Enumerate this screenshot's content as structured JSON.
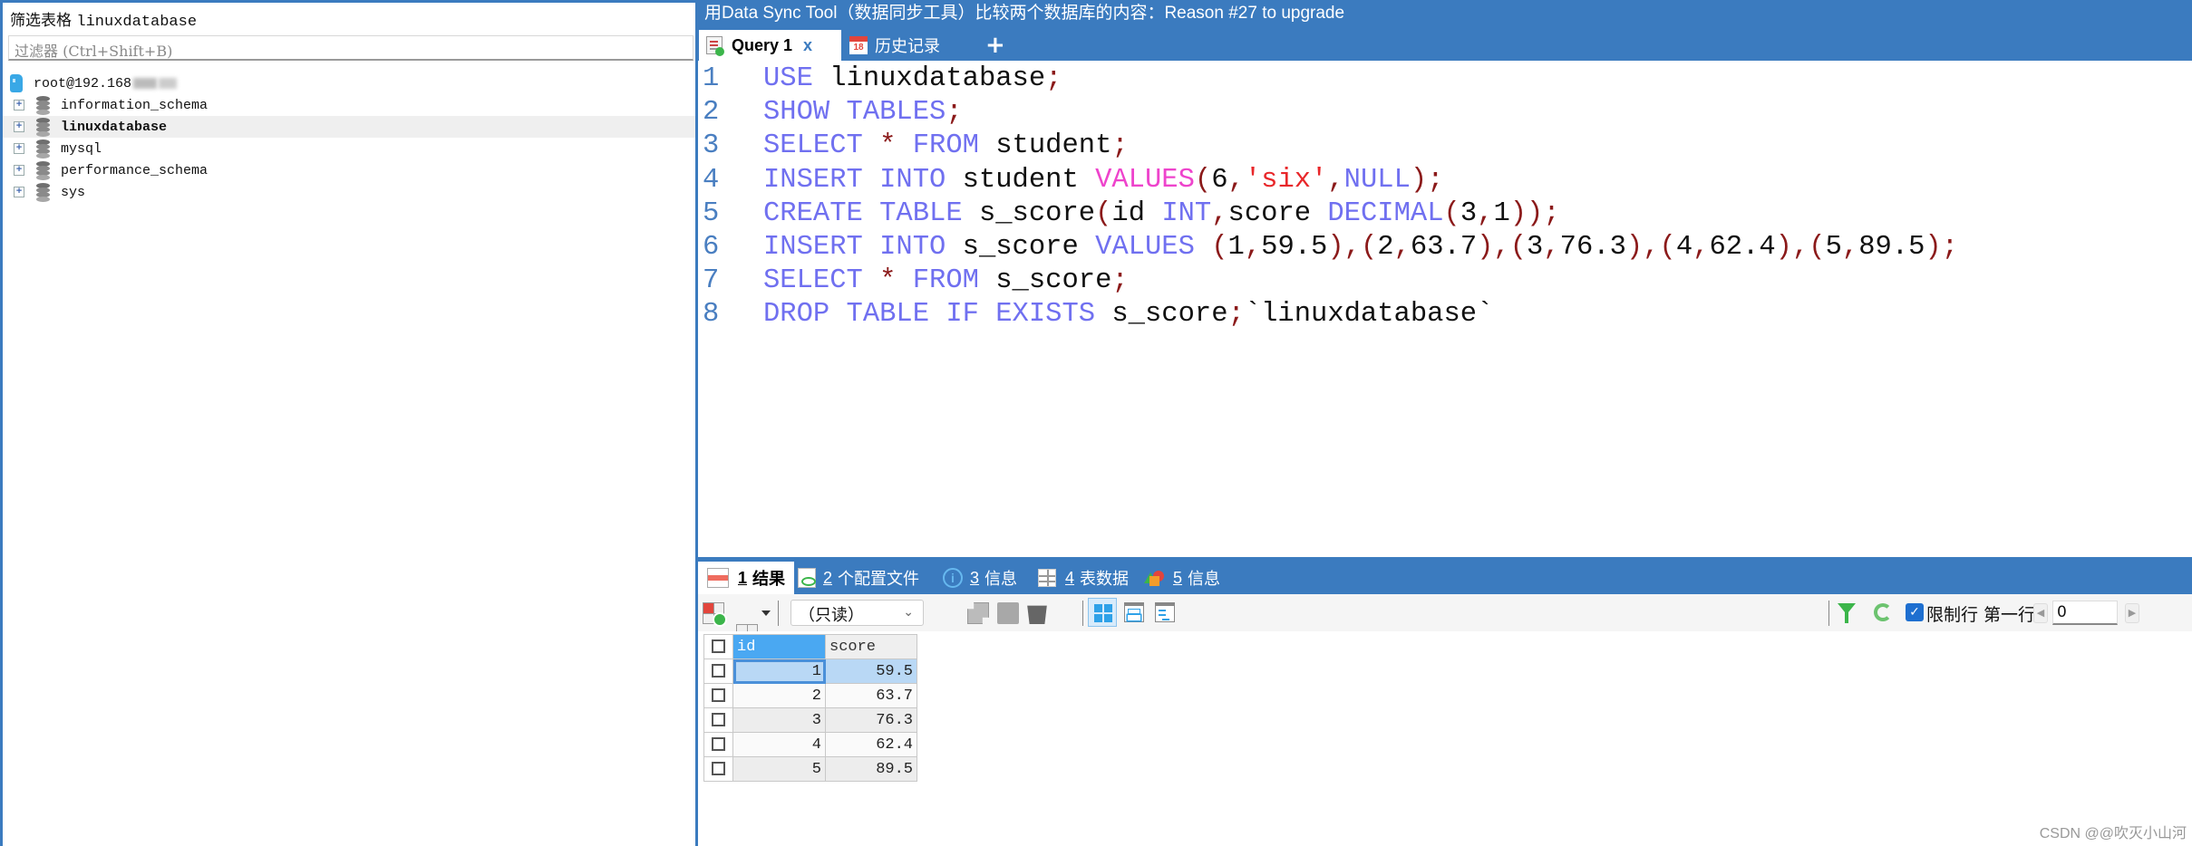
{
  "left_panel": {
    "title_prefix": "筛选表格",
    "title_db": "linuxdatabase",
    "filter_placeholder": "过滤器 (Ctrl+Shift+B)",
    "connection": "root@192.168",
    "databases": [
      {
        "name": "information_schema",
        "selected": false
      },
      {
        "name": "linuxdatabase",
        "selected": true
      },
      {
        "name": "mysql",
        "selected": false
      },
      {
        "name": "performance_schema",
        "selected": false
      },
      {
        "name": "sys",
        "selected": false
      }
    ]
  },
  "window": {
    "title": "用Data Sync Tool（数据同步工具）比较两个数据库的内容：Reason #27 to upgrade"
  },
  "editor_tabs": {
    "query_tab": "Query 1",
    "close": "x",
    "history_tab": "历史记录",
    "history_icon_day": "18",
    "add": "+"
  },
  "code": {
    "line_numbers": [
      "1",
      "2",
      "3",
      "4",
      "5",
      "6",
      "7",
      "8"
    ],
    "lines": [
      [
        [
          "kw",
          "USE "
        ],
        [
          "id",
          "linuxdatabase"
        ],
        [
          "pn",
          ";"
        ]
      ],
      [
        [
          "kw",
          "SHOW TABLES"
        ],
        [
          "pn",
          ";"
        ]
      ],
      [
        [
          "kw",
          "SELECT "
        ],
        [
          "pn",
          "* "
        ],
        [
          "kw",
          "FROM "
        ],
        [
          "id",
          "student"
        ],
        [
          "pn",
          ";"
        ]
      ],
      [
        [
          "kw",
          "INSERT INTO "
        ],
        [
          "id",
          "student "
        ],
        [
          "fn",
          "VALUES"
        ],
        [
          "pn",
          "("
        ],
        [
          "id",
          "6"
        ],
        [
          "pn",
          ","
        ],
        [
          "str",
          "'six'"
        ],
        [
          "pn",
          ","
        ],
        [
          "kw",
          "NULL"
        ],
        [
          "pn",
          ");"
        ]
      ],
      [
        [
          "kw",
          "CREATE TABLE "
        ],
        [
          "id",
          "s_score"
        ],
        [
          "pn",
          "("
        ],
        [
          "id",
          "id "
        ],
        [
          "kw",
          "INT"
        ],
        [
          "pn",
          ","
        ],
        [
          "id",
          "score "
        ],
        [
          "kw",
          "DECIMAL"
        ],
        [
          "pn",
          "("
        ],
        [
          "id",
          "3"
        ],
        [
          "pn",
          ","
        ],
        [
          "id",
          "1"
        ],
        [
          "pn",
          "));"
        ]
      ],
      [
        [
          "kw",
          "INSERT INTO "
        ],
        [
          "id",
          "s_score "
        ],
        [
          "kw",
          "VALUES "
        ],
        [
          "pn",
          "("
        ],
        [
          "id",
          "1"
        ],
        [
          "pn",
          ","
        ],
        [
          "id",
          "59.5"
        ],
        [
          "pn",
          "),("
        ],
        [
          "id",
          "2"
        ],
        [
          "pn",
          ","
        ],
        [
          "id",
          "63.7"
        ],
        [
          "pn",
          "),("
        ],
        [
          "id",
          "3"
        ],
        [
          "pn",
          ","
        ],
        [
          "id",
          "76.3"
        ],
        [
          "pn",
          "),("
        ],
        [
          "id",
          "4"
        ],
        [
          "pn",
          ","
        ],
        [
          "id",
          "62.4"
        ],
        [
          "pn",
          "),("
        ],
        [
          "id",
          "5"
        ],
        [
          "pn",
          ","
        ],
        [
          "id",
          "89.5"
        ],
        [
          "pn",
          ");"
        ]
      ],
      [
        [
          "kw",
          "SELECT "
        ],
        [
          "pn",
          "* "
        ],
        [
          "kw",
          "FROM "
        ],
        [
          "id",
          "s_score"
        ],
        [
          "pn",
          ";"
        ]
      ],
      [
        [
          "kw",
          "DROP TABLE IF EXISTS "
        ],
        [
          "id",
          "s_score"
        ],
        [
          "pn",
          ";"
        ],
        [
          "id",
          "`linuxdatabase`"
        ]
      ]
    ]
  },
  "result_tabs": [
    {
      "num": "1",
      "label": "结果",
      "icon": "result-grid-icon",
      "active": true
    },
    {
      "num": "2",
      "label": "个配置文件",
      "icon": "profile-icon",
      "active": false
    },
    {
      "num": "3",
      "label": "信息",
      "icon": "info-icon",
      "active": false
    },
    {
      "num": "4",
      "label": "表数据",
      "icon": "table-icon",
      "active": false
    },
    {
      "num": "5",
      "label": "信息",
      "icon": "shapes-icon",
      "active": false
    }
  ],
  "result_toolbar": {
    "mode_value": "（只读）",
    "limit_rows_label": "限制行",
    "limit_rows_checked": true,
    "first_row_label": "第一行:",
    "first_row_value": "0"
  },
  "result_grid": {
    "columns": [
      "id",
      "score"
    ],
    "rows": [
      [
        "1",
        "59.5"
      ],
      [
        "2",
        "63.7"
      ],
      [
        "3",
        "76.3"
      ],
      [
        "4",
        "62.4"
      ],
      [
        "5",
        "89.5"
      ]
    ]
  },
  "watermark": "CSDN @@吹灭小山河",
  "colors": {
    "accent": "#3b7bbf",
    "keyword": "#7070f0",
    "function": "#ee44cc",
    "string": "#e8272a",
    "punctuation": "#8b1a1a",
    "line_number": "#4a7fc1"
  }
}
